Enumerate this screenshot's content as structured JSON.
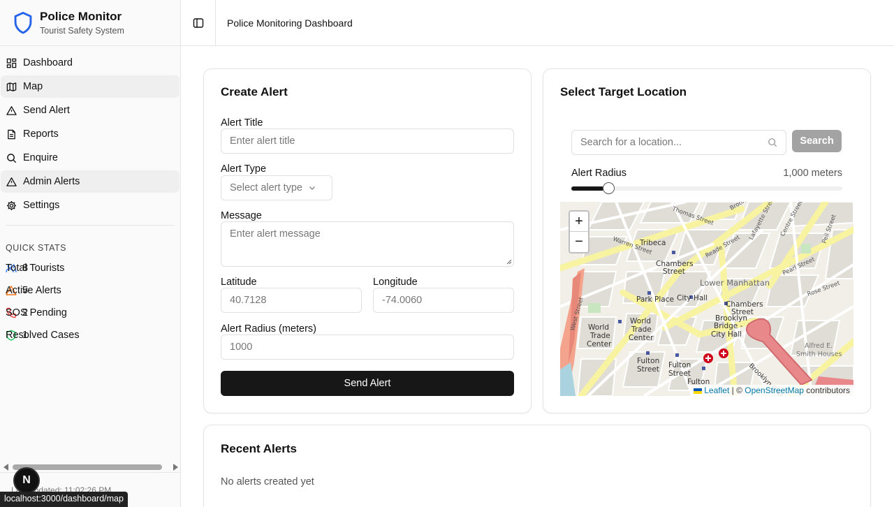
{
  "brand": {
    "title": "Police Monitor",
    "subtitle": "Tourist Safety System"
  },
  "nav": [
    {
      "label": "Dashboard",
      "icon": "dashboard-icon"
    },
    {
      "label": "Map",
      "icon": "map-icon"
    },
    {
      "label": "Send Alert",
      "icon": "alert-triangle-icon"
    },
    {
      "label": "Reports",
      "icon": "file-text-icon"
    },
    {
      "label": "Enquire",
      "icon": "search-icon"
    },
    {
      "label": "Admin Alerts",
      "icon": "alert-triangle-icon"
    },
    {
      "label": "Settings",
      "icon": "gear-icon"
    }
  ],
  "quick_stats": {
    "title": "QUICK STATS",
    "items": [
      {
        "label": "Total Tourists",
        "count": "8",
        "color": "#3b82f6"
      },
      {
        "label": "Active Alerts",
        "count": "5",
        "color": "#f97316"
      },
      {
        "label": "SOS Pending",
        "count": "2",
        "color": "#ef4444"
      },
      {
        "label": "Resolved Cases",
        "count": "1",
        "color": "#22c55e"
      }
    ]
  },
  "footer": {
    "last_updated": "Last updated: 11:02:26 PM",
    "badge": "N",
    "status_url": "localhost:3000/dashboard/map"
  },
  "header": {
    "title": "Police Monitoring Dashboard"
  },
  "create_alert": {
    "title": "Create Alert",
    "alert_title_label": "Alert Title",
    "alert_title_placeholder": "Enter alert title",
    "alert_type_label": "Alert Type",
    "alert_type_placeholder": "Select alert type",
    "message_label": "Message",
    "message_placeholder": "Enter alert message",
    "latitude_label": "Latitude",
    "latitude_placeholder": "40.7128",
    "longitude_label": "Longitude",
    "longitude_placeholder": "-74.0060",
    "radius_label": "Alert Radius (meters)",
    "radius_placeholder": "1000",
    "send_button": "Send Alert"
  },
  "target_location": {
    "title": "Select Target Location",
    "search_placeholder": "Search for a location...",
    "search_button": "Search",
    "radius_label": "Alert Radius",
    "radius_value": "1,000 meters",
    "radius_fraction": 0.11,
    "map_labels": [
      "Tribeca",
      "Chambers Street",
      "Lower Manhattan",
      "Park Place",
      "City Hall",
      "Chambers Street",
      "West Street",
      "World Trade Center",
      "World Trade Center",
      "Brooklyn Bridge City Hall",
      "Brooklyn Bridge",
      "Fulton Street",
      "Fulton Street",
      "Fulton",
      "Thomas Street",
      "Lafayette Street",
      "Centre Street",
      "Pearl Street",
      "Reade Street",
      "Warren Street",
      "Alfred E. Smith Houses",
      "Rose Street"
    ],
    "zoom_in": "+",
    "zoom_out": "−",
    "attribution_leaflet": "Leaflet",
    "attribution_sep": " | © ",
    "attribution_osm": "OpenStreetMap",
    "attribution_tail": " contributors"
  },
  "recent_alerts": {
    "title": "Recent Alerts",
    "empty": "No alerts created yet"
  }
}
